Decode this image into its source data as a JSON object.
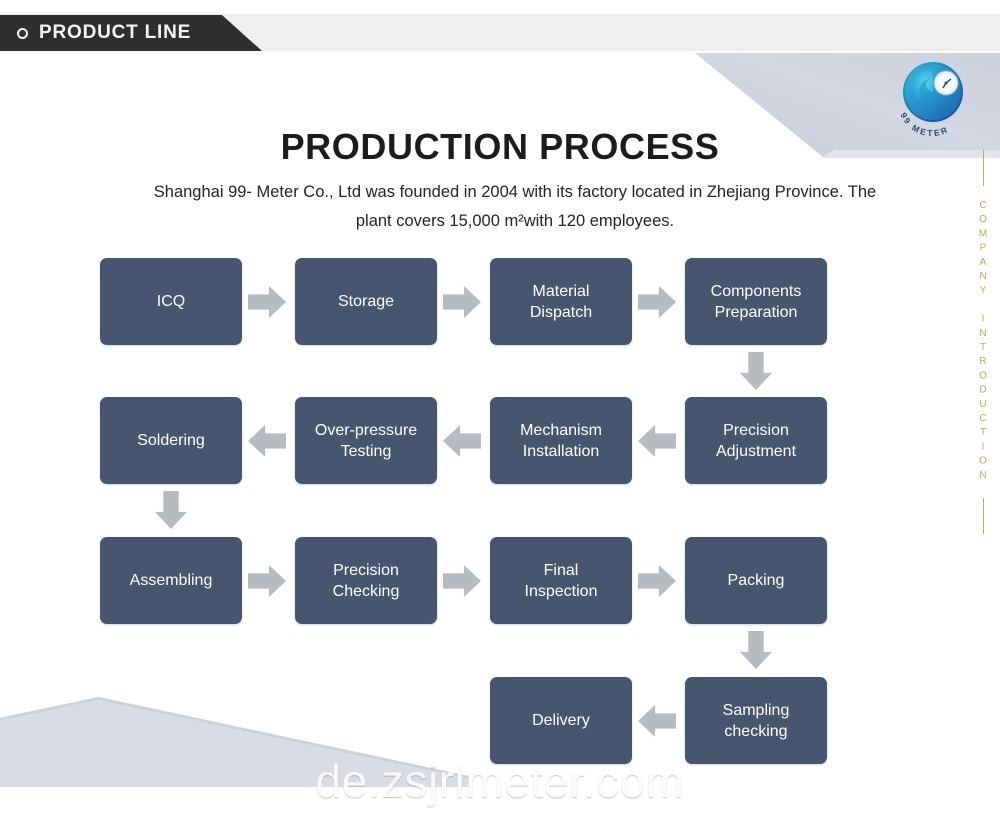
{
  "header": {
    "label": "PRODUCT LINE",
    "bullet_icon": "circle-outline-icon",
    "banner_color": "#2e2e2e"
  },
  "brand": {
    "logo_icon": "99meter-swirl-logo-icon",
    "logo_text": "99 METER",
    "logo_color": "#1f8fd0"
  },
  "side_rail": {
    "text": "COMPANY INTRODUCTION",
    "color": "#c6a455"
  },
  "main": {
    "title": "PRODUCTION PROCESS",
    "subtitle": "Shanghai 99- Meter Co., Ltd was founded in 2004 with its factory located in Zhejiang Province. The plant covers 15,000 m²with 120 employees.",
    "box_color": "#47566f",
    "arrow_color": "#b6bac1"
  },
  "flow": {
    "rows": [
      {
        "direction": "right",
        "steps": [
          {
            "label": "ICQ"
          },
          {
            "label": "Storage"
          },
          {
            "label_line1": "Material",
            "label_line2": "Dispatch"
          },
          {
            "label_line1": "Components",
            "label_line2": "Preparation"
          }
        ]
      },
      {
        "direction": "left",
        "steps": [
          {
            "label": "Soldering"
          },
          {
            "label_line1": "Over-pressure",
            "label_line2": "Testing"
          },
          {
            "label_line1": "Mechanism",
            "label_line2": "Installation"
          },
          {
            "label_line1": "Precision",
            "label_line2": "Adjustment"
          }
        ]
      },
      {
        "direction": "right",
        "steps": [
          {
            "label": "Assembling"
          },
          {
            "label_line1": "Precision",
            "label_line2": "Checking"
          },
          {
            "label_line1": "Final",
            "label_line2": "Inspection"
          },
          {
            "label": "Packing"
          }
        ]
      },
      {
        "direction": "left",
        "steps": [
          {
            "label": "Delivery"
          },
          {
            "label_line1": "Sampling",
            "label_line2": "checking"
          }
        ]
      }
    ]
  },
  "watermark": {
    "text": "de.zsjrlmeter.com"
  }
}
